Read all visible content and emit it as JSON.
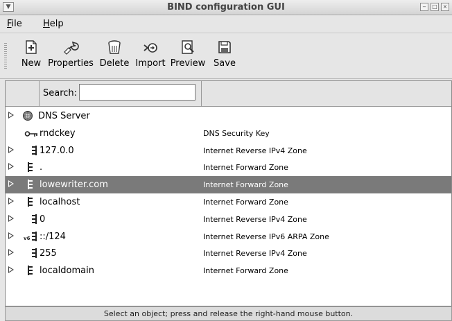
{
  "window": {
    "title": "BIND configuration GUI",
    "menu_glyph": "▼",
    "min_glyph": "‒",
    "max_glyph": "□",
    "close_glyph": "×"
  },
  "menubar": {
    "items": [
      {
        "label": "File",
        "mnemonic": "F",
        "rest": "ile"
      },
      {
        "label": "Help",
        "mnemonic": "H",
        "rest": "elp"
      }
    ]
  },
  "toolbar": {
    "buttons": [
      {
        "label": "New",
        "icon": "new-icon"
      },
      {
        "label": "Properties",
        "icon": "wrench-icon"
      },
      {
        "label": "Delete",
        "icon": "trash-icon"
      },
      {
        "label": "Import",
        "icon": "import-icon"
      },
      {
        "label": "Preview",
        "icon": "preview-icon"
      },
      {
        "label": "Save",
        "icon": "floppy-icon"
      }
    ]
  },
  "search": {
    "label": "Search:",
    "value": ""
  },
  "tree": {
    "rows": [
      {
        "name": "DNS Server",
        "type": "",
        "icon": "server-icon",
        "expander": true,
        "selected": false
      },
      {
        "name": "rndckey",
        "type": "DNS Security Key",
        "icon": "key-icon",
        "expander": false,
        "selected": false
      },
      {
        "name": "127.0.0",
        "type": "Internet Reverse IPv4 Zone",
        "icon": "reverse-zone-icon",
        "expander": true,
        "selected": false
      },
      {
        "name": ".",
        "type": "Internet Forward Zone",
        "icon": "forward-zone-icon",
        "expander": true,
        "selected": false
      },
      {
        "name": "lowewriter.com",
        "type": "Internet Forward Zone",
        "icon": "forward-zone-icon",
        "expander": true,
        "selected": true
      },
      {
        "name": "localhost",
        "type": "Internet Forward Zone",
        "icon": "forward-zone-icon",
        "expander": true,
        "selected": false
      },
      {
        "name": "0",
        "type": "Internet Reverse IPv4 Zone",
        "icon": "reverse-zone-icon",
        "expander": true,
        "selected": false
      },
      {
        "name": "::/124",
        "type": "Internet Reverse IPv6 ARPA Zone",
        "icon": "reverse-v6-zone-icon",
        "expander": true,
        "selected": false
      },
      {
        "name": "255",
        "type": "Internet Reverse IPv4 Zone",
        "icon": "reverse-zone-icon",
        "expander": true,
        "selected": false
      },
      {
        "name": "localdomain",
        "type": "Internet Forward Zone",
        "icon": "forward-zone-icon",
        "expander": true,
        "selected": false
      }
    ]
  },
  "status": {
    "text": "Select an object; press and release the right-hand mouse button."
  },
  "colors": {
    "selected_row": "#7a7a7a",
    "window_bg": "#e6e6e6"
  }
}
